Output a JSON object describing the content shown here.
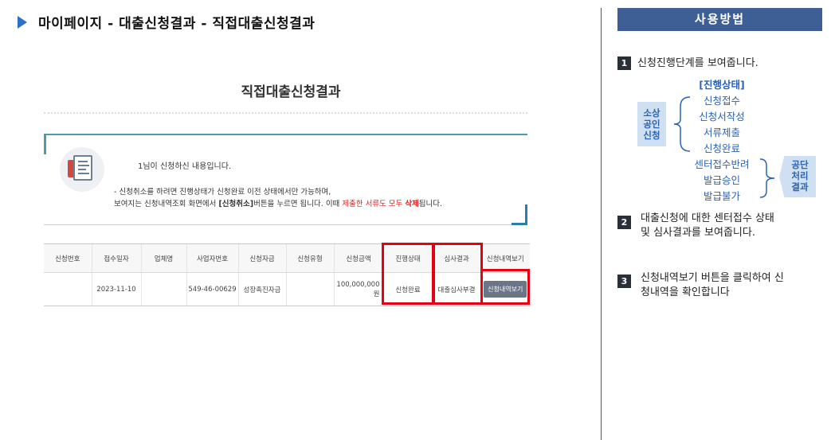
{
  "header": {
    "breadcrumb": "마이페이지 - 대출신청결과 - 직접대출신청결과"
  },
  "screenshot": {
    "title": "직접대출신청결과",
    "info": {
      "line1": "1님이 신청하신 내용입니다.",
      "line2": "- 신청취소를 하려면 진행상태가 신청완료 이전 상태에서만 가능하며,",
      "line3_part1": "보여지는 신청내역조회 화면에서 ",
      "line3_bold": "[신청취소]",
      "line3_part2": "버튼을 누르면 됩니다. 이때 ",
      "line3_red1": "제출한 서류도 모두 ",
      "line3_red2": "삭제",
      "line3_part3": "됩니다."
    },
    "table": {
      "headers": [
        "신청번호",
        "접수일자",
        "업체명",
        "사업자번호",
        "신청자금",
        "신청유형",
        "신청금액",
        "진행상태",
        "심사결과",
        "신청내역보기"
      ],
      "row": {
        "app_no": "",
        "date": "2023-11-10",
        "company": "",
        "biz_no": "549-46-00629",
        "fund": "성장촉진자금",
        "type": "",
        "amount": "100,000,000 원",
        "status": "신청완료",
        "review": "대출심사부결",
        "view_button": "신청내역보기"
      }
    }
  },
  "usage_panel": {
    "title": "사용방법",
    "step1": {
      "number": "1",
      "text": "신청진행단계를 보여줍니다.",
      "stage_header": "[진행상태]",
      "left_badge": [
        "소상",
        "공인",
        "신청"
      ],
      "applicant_stages": [
        "신청접수",
        "신청서작성",
        "서류제출",
        "신청완료"
      ],
      "agency_stages": [
        "센터접수반려",
        "발급승인",
        "발급불가"
      ],
      "right_badge": [
        "공단",
        "처리",
        "결과"
      ]
    },
    "step2": {
      "number": "2",
      "line1": "대출신청에 대한 센터접수 상태",
      "line2": "및 심사결과를 보여줍니다."
    },
    "step3": {
      "number": "3",
      "line1": "신청내역보기 버튼을 클릭하여 신",
      "line2": "청내역을 확인합니다"
    }
  },
  "colors": {
    "accent": "#3e5f95",
    "highlight": "#e60012",
    "stage_blue": "#2a63b5",
    "arrow": "#2f6fc9"
  }
}
